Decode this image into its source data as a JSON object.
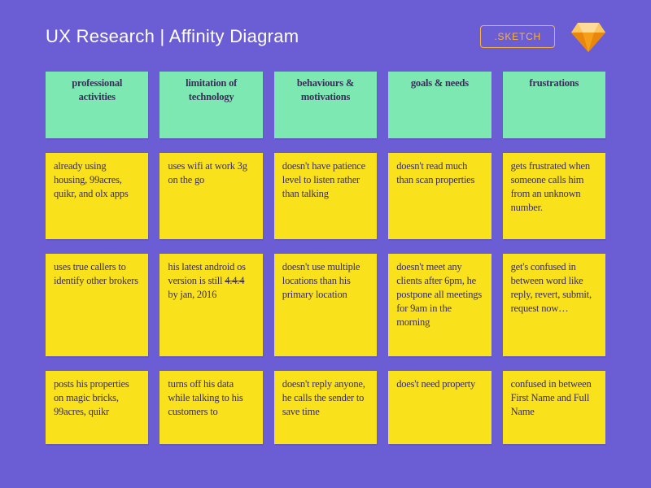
{
  "header": {
    "title": "UX Research | Affinity Diagram",
    "button_label": ".SKETCH"
  },
  "categories": [
    "professional activities",
    "limitation of technology",
    "behaviours & motivations",
    "goals & needs",
    "frustrations"
  ],
  "rows": [
    [
      "already using housing, 99acres, quikr, and olx apps",
      "uses wifi at work 3g on the go",
      "doesn't have patience level to listen rather than talking",
      "doesn't read much than scan properties",
      "gets frustrated when someone calls him from an unknown number."
    ],
    [
      "uses true callers to identify other brokers",
      {
        "pre": "his latest android os version is still ",
        "strike": "4.4.4",
        "post": " by jan, 2016"
      },
      "doesn't use multiple locations than his primary location",
      "doesn't meet any clients after 6pm, he postpone all meetings for 9am in the morning",
      "get's confused in between word like reply, revert, submit, request now…"
    ],
    [
      "posts his properties on magic bricks, 99acres, quikr",
      "turns off his data while talking to his customers to",
      "doesn't reply anyone, he calls the sender to save time",
      "does't need property",
      "confused in between First Name and Full Name"
    ]
  ],
  "colors": {
    "bg": "#6b5ed4",
    "category_note": "#7de8b1",
    "data_note": "#f9e21b",
    "accent": "#f9b23b"
  }
}
